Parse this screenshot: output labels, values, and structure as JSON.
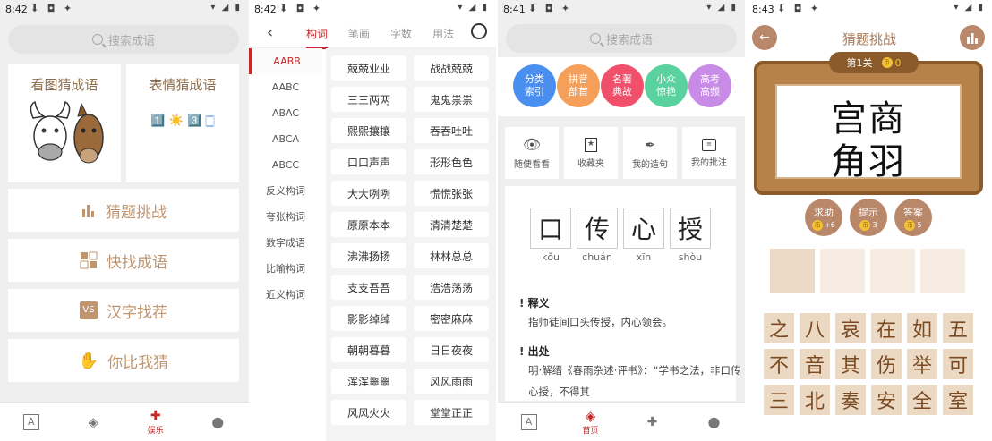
{
  "screen1": {
    "time": "8:42",
    "search_placeholder": "搜索成语",
    "cards": [
      "看图猜成语",
      "表情猜成语"
    ],
    "emoji_line": "1️⃣ ☀️ 3️⃣ 🀆",
    "menu": [
      {
        "label": "猜题挑战",
        "icon": "bar-chart-icon"
      },
      {
        "label": "快找成语",
        "icon": "grid-icon"
      },
      {
        "label": "汉字找茬",
        "icon": "vs-icon"
      },
      {
        "label": "你比我猜",
        "icon": "hand-icon"
      }
    ],
    "tabbar": [
      {
        "label": "",
        "icon": "font-icon"
      },
      {
        "label": "",
        "icon": "layers-icon"
      },
      {
        "label": "娱乐",
        "icon": "game-icon",
        "active": true
      },
      {
        "label": "",
        "icon": "person-icon"
      }
    ]
  },
  "screen2": {
    "time": "8:42",
    "tabs": [
      "构词",
      "笔画",
      "字数",
      "用法"
    ],
    "active_tab": "构词",
    "left_items": [
      "AABB",
      "AABC",
      "ABAC",
      "ABCA",
      "ABCC",
      "反义构词",
      "夸张构词",
      "数字成语",
      "比喻构词",
      "近义构词"
    ],
    "words": [
      "兢兢业业",
      "战战兢兢",
      "三三两两",
      "鬼鬼祟祟",
      "熙熙攘攘",
      "吞吞吐吐",
      "口口声声",
      "形形色色",
      "大大咧咧",
      "慌慌张张",
      "原原本本",
      "清清楚楚",
      "沸沸扬扬",
      "林林总总",
      "支支吾吾",
      "浩浩荡荡",
      "影影绰绰",
      "密密麻麻",
      "朝朝暮暮",
      "日日夜夜",
      "浑浑噩噩",
      "风风雨雨",
      "风风火火",
      "堂堂正正"
    ]
  },
  "screen3": {
    "time": "8:41",
    "search_placeholder": "搜索成语",
    "categories": [
      {
        "label": "分类\n索引",
        "color": "#4a8ef0"
      },
      {
        "label": "拼音\n部首",
        "color": "#f5a05a"
      },
      {
        "label": "名著\n典故",
        "color": "#f0506a"
      },
      {
        "label": "小众\n惊艳",
        "color": "#5ad2a0"
      },
      {
        "label": "高考\n高频",
        "color": "#c88ce6"
      }
    ],
    "actions": [
      {
        "label": "随便看看",
        "icon": "eye-icon"
      },
      {
        "label": "收藏夹",
        "icon": "star-bookmark-icon"
      },
      {
        "label": "我的造句",
        "icon": "feather-icon"
      },
      {
        "label": "我的批注",
        "icon": "comment-icon"
      }
    ],
    "idiom_chars": [
      "口",
      "传",
      "心",
      "授"
    ],
    "pinyin": [
      "kǒu",
      "chuán",
      "xīn",
      "shòu"
    ],
    "meaning_title": "释义",
    "meaning": "指师徒间口头传授，内心领会。",
    "source_title": "出处",
    "source": "明·解缙《春雨杂述·评书》：“学书之法，非口传心授，不得其",
    "tabbar": [
      {
        "label": "",
        "icon": "font-icon"
      },
      {
        "label": "首页",
        "icon": "layers-icon",
        "active": true
      },
      {
        "label": "",
        "icon": "game-icon"
      },
      {
        "label": "",
        "icon": "person-icon"
      }
    ]
  },
  "screen4": {
    "time": "8:43",
    "title": "猜题挑战",
    "level": "第1关",
    "coins": "0",
    "idiom_line1": "宫商",
    "idiom_line2": "角羽",
    "help_buttons": [
      {
        "label": "求助",
        "cost": "+6"
      },
      {
        "label": "提示",
        "cost": "3"
      },
      {
        "label": "答案",
        "cost": "5"
      }
    ],
    "options": [
      "之",
      "八",
      "哀",
      "在",
      "如",
      "五",
      "不",
      "音",
      "其",
      "伤",
      "举",
      "可",
      "三",
      "北",
      "奏",
      "安",
      "全",
      "室"
    ]
  }
}
